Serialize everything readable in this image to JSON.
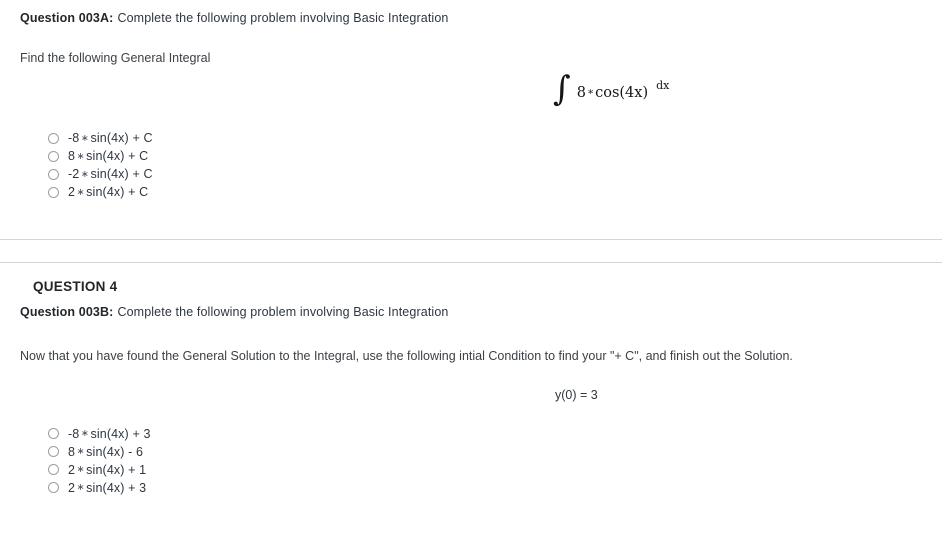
{
  "question_a": {
    "label": "Question 003A:",
    "prompt": "Complete the following problem involving Basic Integration",
    "instruction": "Find the following General Integral",
    "expression": {
      "integral_sign": "∫",
      "integrand_coefficient": "8",
      "operator": "∗",
      "integrand_function": "cos(4x)",
      "differential": "dx",
      "plain_text": "∫ 8 * cos(4x) dx"
    },
    "options": [
      {
        "coefficient": "-8",
        "operator": "∗",
        "term": "sin(4x) + C",
        "plain_text": "-8 * sin(4x) + C"
      },
      {
        "coefficient": "8",
        "operator": "∗",
        "term": "sin(4x) + C",
        "plain_text": "8 * sin(4x) + C"
      },
      {
        "coefficient": "-2",
        "operator": "∗",
        "term": "sin(4x) + C",
        "plain_text": "-2 * sin(4x) + C"
      },
      {
        "coefficient": "2",
        "operator": "∗",
        "term": "sin(4x) + C",
        "plain_text": "2 * sin(4x) + C"
      }
    ]
  },
  "question_4": {
    "heading": "QUESTION 4",
    "label": "Question 003B:",
    "prompt": "Complete the following problem involving Basic Integration",
    "instruction": "Now that you have found the General Solution to the Integral, use the following intial Condition to find your \"+ C\", and finish out the Solution.",
    "condition": "y(0) = 3",
    "options": [
      {
        "coefficient": "-8",
        "operator": "∗",
        "term": "sin(4x) + 3",
        "plain_text": "-8 * sin(4x) + 3"
      },
      {
        "coefficient": "8",
        "operator": "∗",
        "term": "sin(4x) - 6",
        "plain_text": "8 * sin(4x) - 6"
      },
      {
        "coefficient": "2",
        "operator": "∗",
        "term": "sin(4x) + 1",
        "plain_text": "2 * sin(4x) + 1"
      },
      {
        "coefficient": "2",
        "operator": "∗",
        "term": "sin(4x) + 3",
        "plain_text": "2 * sin(4x) + 3"
      }
    ]
  },
  "colors": {
    "text": "#2f3640",
    "heading": "#21252a",
    "divider": "#d6d6d6",
    "radio_border": "#9aa0a6",
    "background": "#ffffff"
  }
}
